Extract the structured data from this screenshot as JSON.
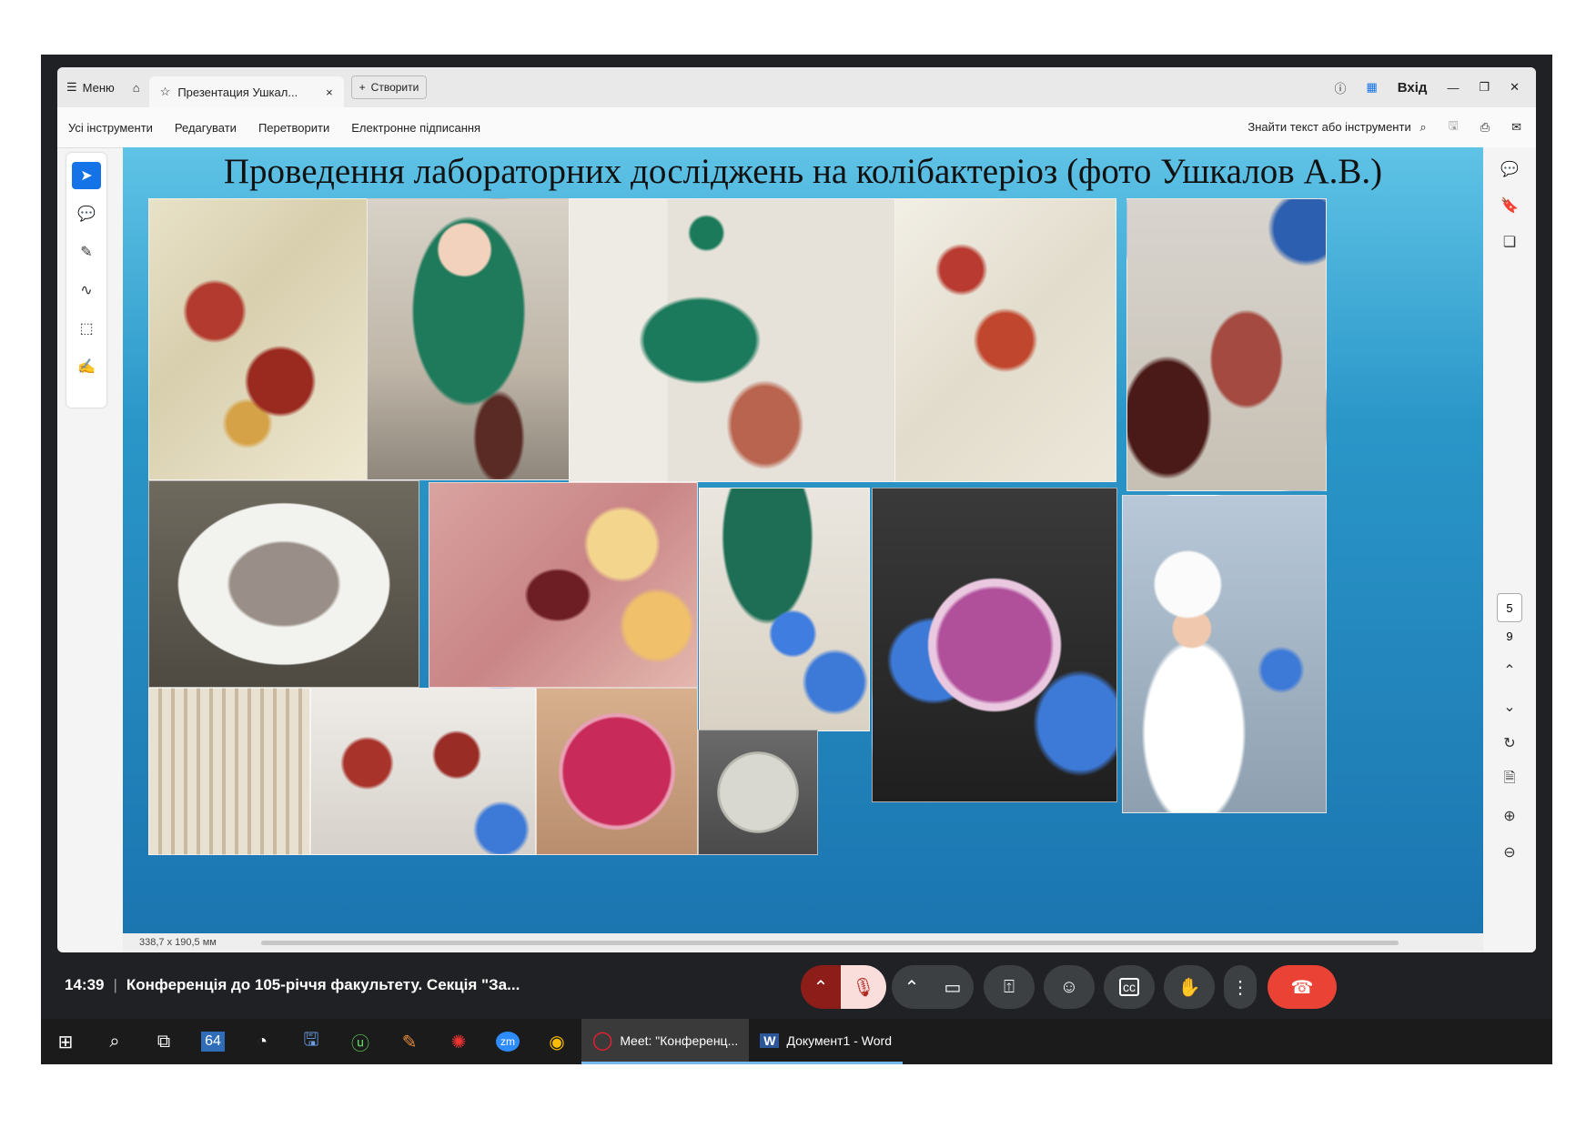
{
  "titlebar": {
    "menu_label": "Меню",
    "tab_title": "Презентация Ушкал...",
    "new_tab_label": "Створити",
    "signin_label": "Вхід"
  },
  "menubar": {
    "items": [
      "Усі інструменти",
      "Редагувати",
      "Перетворити",
      "Електронне підписання"
    ],
    "search_label": "Знайти текст або інструменти"
  },
  "slide": {
    "title": "Проведення лабораторних досліджень на колібактеріоз (фото Ушкалов А.В.)"
  },
  "viewer": {
    "page_current": "5",
    "page_total": "9",
    "page_size": "338,7 x 190,5 мм"
  },
  "meet": {
    "time": "14:39",
    "meeting_title": "Конференція до 105-річчя факультету. Секція \"За..."
  },
  "taskbar": {
    "counter_label": "64",
    "zoom_label": "zm",
    "apps": [
      {
        "label": "Meet: \"Конференц..."
      },
      {
        "label": "Документ1 - Word"
      }
    ]
  },
  "colors": {
    "accent": "#1473e6",
    "slide_bg": "#2a96c8",
    "end_call": "#ea4335",
    "muted": "#f9dedc"
  }
}
